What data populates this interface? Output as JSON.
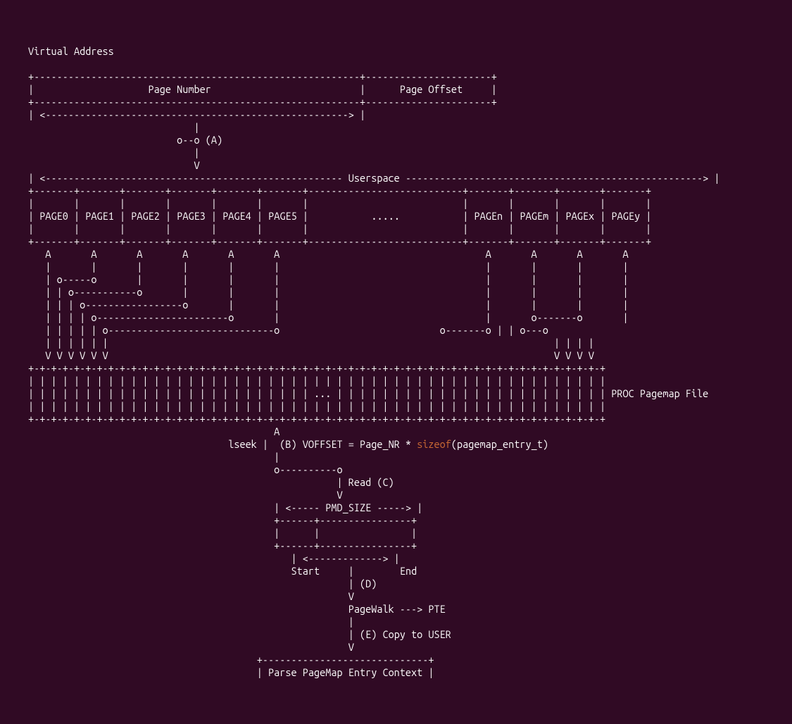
{
  "title": "Virtual Address",
  "header": {
    "page_number": "Page Number",
    "page_offset": "Page Offset"
  },
  "step_a": "(A)",
  "userspace": "Userspace",
  "pages": [
    "PAGE0",
    "PAGE1",
    "PAGE2",
    "PAGE3",
    "PAGE4",
    "PAGE5",
    ".....",
    "PAGEn",
    "PAGEm",
    "PAGEx",
    "PAGEy"
  ],
  "pagemap_label": "PROC Pagemap File",
  "lseek": "lseek",
  "step_b_prefix": "(B) VOFFSET = Page_NR * ",
  "sizeof": "sizeof",
  "step_b_suffix": "(pagemap_entry_t)",
  "read_c": "Read (C)",
  "pmd_size": "PMD_SIZE",
  "start": "Start",
  "end": "End",
  "step_d": "(D)",
  "pagewalk": "PageWalk ---> PTE",
  "step_e": "(E) Copy to USER",
  "parse": "Parse PageMap Entry Context"
}
